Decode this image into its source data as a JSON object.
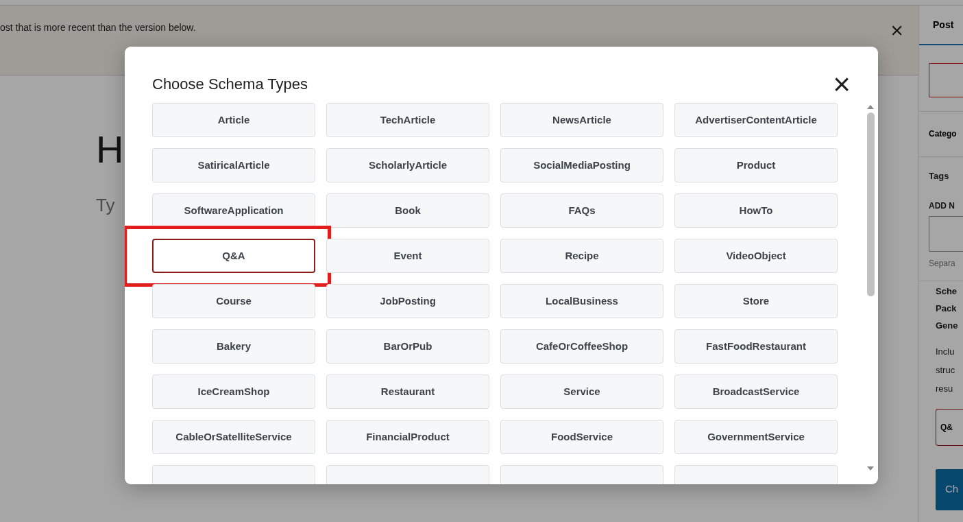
{
  "notice": {
    "text": "ost that is more recent than the version below.",
    "close": "×"
  },
  "editor": {
    "title": "H",
    "placeholder": "Ty"
  },
  "sidebar": {
    "tabs": [
      {
        "label": "Post",
        "selected": true
      }
    ],
    "panels": [
      {
        "kind": "box"
      },
      {
        "kind": "heading",
        "label": "Catego"
      },
      {
        "kind": "tags",
        "label": "Tags",
        "field_label": "ADD N",
        "help": "Separa"
      },
      {
        "kind": "schema",
        "heading_lines": [
          "Sche",
          "Pack",
          "Gene"
        ],
        "text_lines": [
          "Inclu",
          "struc",
          "resu"
        ],
        "chip": "Q&",
        "button": "Ch"
      }
    ]
  },
  "modal": {
    "title": "Choose Schema Types",
    "close": "×",
    "items": [
      {
        "kind": "full",
        "label": "Article",
        "selected": false,
        "highlight": false
      },
      {
        "kind": "full",
        "label": "TechArticle",
        "selected": false,
        "highlight": false
      },
      {
        "kind": "full",
        "label": "NewsArticle",
        "selected": false,
        "highlight": false
      },
      {
        "kind": "full",
        "label": "AdvertiserContentArticle",
        "selected": false,
        "highlight": false
      },
      {
        "kind": "full",
        "label": "SatiricalArticle",
        "selected": false,
        "highlight": false
      },
      {
        "kind": "full",
        "label": "ScholarlyArticle",
        "selected": false,
        "highlight": false
      },
      {
        "kind": "full",
        "label": "SocialMediaPosting",
        "selected": false,
        "highlight": false
      },
      {
        "kind": "full",
        "label": "Product",
        "selected": false,
        "highlight": false
      },
      {
        "kind": "full",
        "label": "SoftwareApplication",
        "selected": false,
        "highlight": false
      },
      {
        "kind": "full",
        "label": "Book",
        "selected": false,
        "highlight": false
      },
      {
        "kind": "full",
        "label": "FAQs",
        "selected": false,
        "highlight": false
      },
      {
        "kind": "full",
        "label": "HowTo",
        "selected": false,
        "highlight": false
      },
      {
        "kind": "full",
        "label": "Q&A",
        "selected": true,
        "highlight": true
      },
      {
        "kind": "full",
        "label": "Event",
        "selected": false,
        "highlight": false
      },
      {
        "kind": "full",
        "label": "Recipe",
        "selected": false,
        "highlight": false
      },
      {
        "kind": "full",
        "label": "VideoObject",
        "selected": false,
        "highlight": false
      },
      {
        "kind": "full",
        "label": "Course",
        "selected": false,
        "highlight": false
      },
      {
        "kind": "full",
        "label": "JobPosting",
        "selected": false,
        "highlight": false
      },
      {
        "kind": "full",
        "label": "LocalBusiness",
        "selected": false,
        "highlight": false
      },
      {
        "kind": "full",
        "label": "Store",
        "selected": false,
        "highlight": false
      },
      {
        "kind": "full",
        "label": "Bakery",
        "selected": false,
        "highlight": false
      },
      {
        "kind": "full",
        "label": "BarOrPub",
        "selected": false,
        "highlight": false
      },
      {
        "kind": "full",
        "label": "CafeOrCoffeeShop",
        "selected": false,
        "highlight": false
      },
      {
        "kind": "full",
        "label": "FastFoodRestaurant",
        "selected": false,
        "highlight": false
      },
      {
        "kind": "full",
        "label": "IceCreamShop",
        "selected": false,
        "highlight": false
      },
      {
        "kind": "full",
        "label": "Restaurant",
        "selected": false,
        "highlight": false
      },
      {
        "kind": "full",
        "label": "Service",
        "selected": false,
        "highlight": false
      },
      {
        "kind": "full",
        "label": "BroadcastService",
        "selected": false,
        "highlight": false
      },
      {
        "kind": "full",
        "label": "CableOrSatelliteService",
        "selected": false,
        "highlight": false
      },
      {
        "kind": "full",
        "label": "FinancialProduct",
        "selected": false,
        "highlight": false
      },
      {
        "kind": "full",
        "label": "FoodService",
        "selected": false,
        "highlight": false
      },
      {
        "kind": "full",
        "label": "GovernmentService",
        "selected": false,
        "highlight": false
      },
      {
        "kind": "cut",
        "selected": false,
        "highlight": false
      },
      {
        "kind": "cut",
        "selected": false,
        "highlight": false
      },
      {
        "kind": "cut",
        "selected": false,
        "highlight": false
      },
      {
        "kind": "cut",
        "selected": false,
        "highlight": false
      }
    ]
  }
}
